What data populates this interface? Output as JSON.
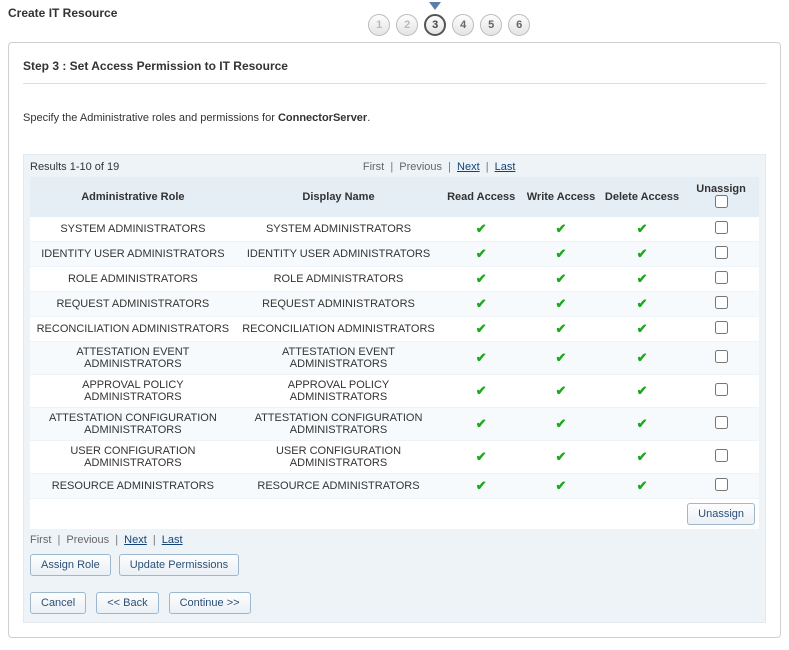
{
  "header": {
    "title": "Create IT Resource",
    "steps": [
      "1",
      "2",
      "3",
      "4",
      "5",
      "6"
    ],
    "current_step_index": 2,
    "disabled_steps": [
      0,
      1
    ]
  },
  "step": {
    "title": "Step 3 : Set Access Permission to IT Resource",
    "instr_prefix": "Specify the Administrative roles and permissions for ",
    "instr_target": "ConnectorServer",
    "instr_suffix": "."
  },
  "table": {
    "results_msg": "Results 1-10 of 19",
    "pager": {
      "first": "First",
      "previous": "Previous",
      "next": "Next",
      "last": "Last"
    },
    "headers": {
      "role": "Administrative Role",
      "display": "Display Name",
      "read": "Read Access",
      "write": "Write Access",
      "delete": "Delete Access",
      "unassign": "Unassign"
    },
    "unassign_button": "Unassign",
    "rows": [
      {
        "role": "SYSTEM ADMINISTRATORS",
        "display": "SYSTEM ADMINISTRATORS",
        "read": true,
        "write": true,
        "delete": true
      },
      {
        "role": "IDENTITY USER ADMINISTRATORS",
        "display": "IDENTITY USER ADMINISTRATORS",
        "read": true,
        "write": true,
        "delete": true
      },
      {
        "role": "ROLE ADMINISTRATORS",
        "display": "ROLE ADMINISTRATORS",
        "read": true,
        "write": true,
        "delete": true
      },
      {
        "role": "REQUEST ADMINISTRATORS",
        "display": "REQUEST ADMINISTRATORS",
        "read": true,
        "write": true,
        "delete": true
      },
      {
        "role": "RECONCILIATION ADMINISTRATORS",
        "display": "RECONCILIATION ADMINISTRATORS",
        "read": true,
        "write": true,
        "delete": true
      },
      {
        "role": "ATTESTATION EVENT ADMINISTRATORS",
        "display": "ATTESTATION EVENT ADMINISTRATORS",
        "read": true,
        "write": true,
        "delete": true
      },
      {
        "role": "APPROVAL POLICY ADMINISTRATORS",
        "display": "APPROVAL POLICY ADMINISTRATORS",
        "read": true,
        "write": true,
        "delete": true
      },
      {
        "role": "ATTESTATION CONFIGURATION ADMINISTRATORS",
        "display": "ATTESTATION CONFIGURATION ADMINISTRATORS",
        "read": true,
        "write": true,
        "delete": true
      },
      {
        "role": "USER CONFIGURATION ADMINISTRATORS",
        "display": "USER CONFIGURATION ADMINISTRATORS",
        "read": true,
        "write": true,
        "delete": true
      },
      {
        "role": "RESOURCE ADMINISTRATORS",
        "display": "RESOURCE ADMINISTRATORS",
        "read": true,
        "write": true,
        "delete": true
      }
    ]
  },
  "actions": {
    "assign_role": "Assign Role",
    "update_permissions": "Update Permissions"
  },
  "nav": {
    "cancel": "Cancel",
    "back": "<< Back",
    "continue": "Continue >>"
  }
}
